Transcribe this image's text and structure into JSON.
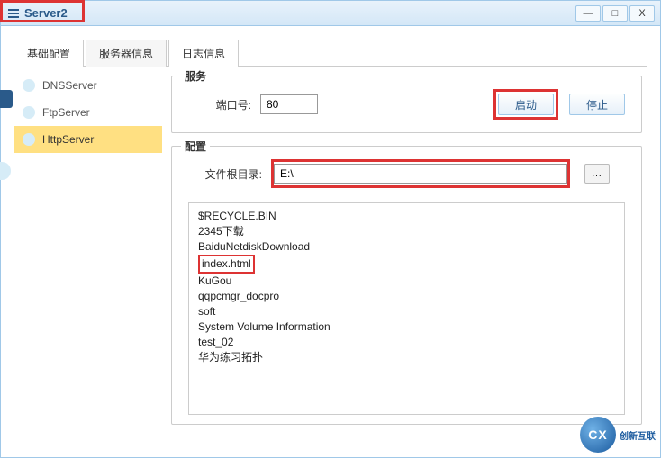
{
  "window": {
    "title": "Server2",
    "min": "—",
    "max": "□",
    "close": "X"
  },
  "tabs": {
    "items": [
      {
        "label": "基础配置"
      },
      {
        "label": "服务器信息"
      },
      {
        "label": "日志信息"
      }
    ]
  },
  "sidebar": {
    "items": [
      {
        "label": "DNSServer"
      },
      {
        "label": "FtpServer"
      },
      {
        "label": "HttpServer"
      }
    ]
  },
  "service": {
    "legend": "服务",
    "port_label": "端口号:",
    "port_value": "80",
    "start_label": "启动",
    "stop_label": "停止"
  },
  "config": {
    "legend": "配置",
    "rootdir_label": "文件根目录:",
    "rootdir_value": "E:\\",
    "browse_label": "...",
    "listing": [
      "$RECYCLE.BIN",
      "2345下载",
      "BaiduNetdiskDownload",
      "index.html",
      "KuGou",
      "qqpcmgr_docpro",
      "soft",
      "System Volume Information",
      "test_02",
      "华为练习拓扑"
    ]
  },
  "logo": {
    "mark": "CX",
    "text": "创新互联"
  }
}
